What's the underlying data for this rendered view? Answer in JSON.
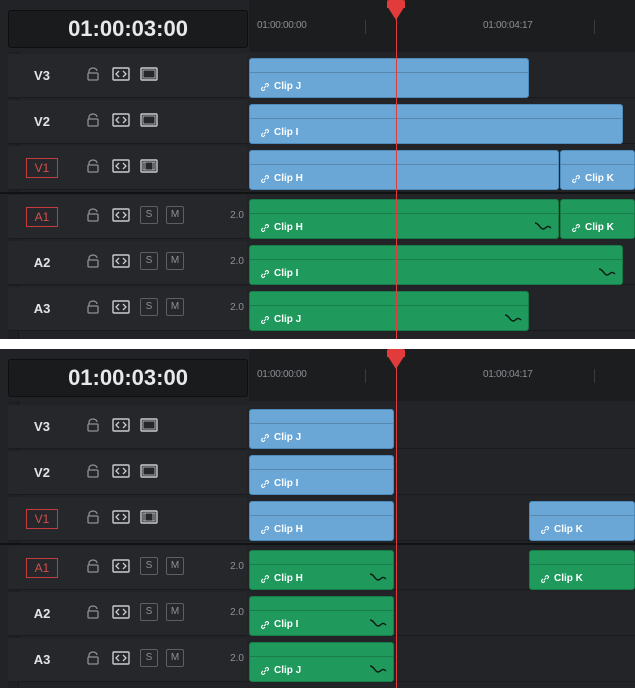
{
  "timecode": "01:00:03:00",
  "ruler": {
    "label_start": "01:00:00:00",
    "label_mid": "01:00:04:17"
  },
  "colors": {
    "video_clip": "#6aa7d6",
    "audio_clip": "#1f9a5c",
    "playhead": "#e23b3b",
    "background": "#222326"
  },
  "tracks": {
    "v3": {
      "name": "V3"
    },
    "v2": {
      "name": "V2"
    },
    "v1": {
      "name": "V1"
    },
    "a1": {
      "name": "A1",
      "volume": "2.0",
      "solo": "S",
      "mute": "M"
    },
    "a2": {
      "name": "A2",
      "volume": "2.0",
      "solo": "S",
      "mute": "M"
    },
    "a3": {
      "name": "A3",
      "volume": "2.0",
      "solo": "S",
      "mute": "M"
    }
  },
  "clips": {
    "j": "Clip J",
    "i": "Clip I",
    "h": "Clip H",
    "k": "Clip K"
  },
  "icons": [
    "lock-icon",
    "auto-select-icon",
    "monitor-icon",
    "link-icon",
    "fade-curve-icon",
    "playhead-icon"
  ]
}
